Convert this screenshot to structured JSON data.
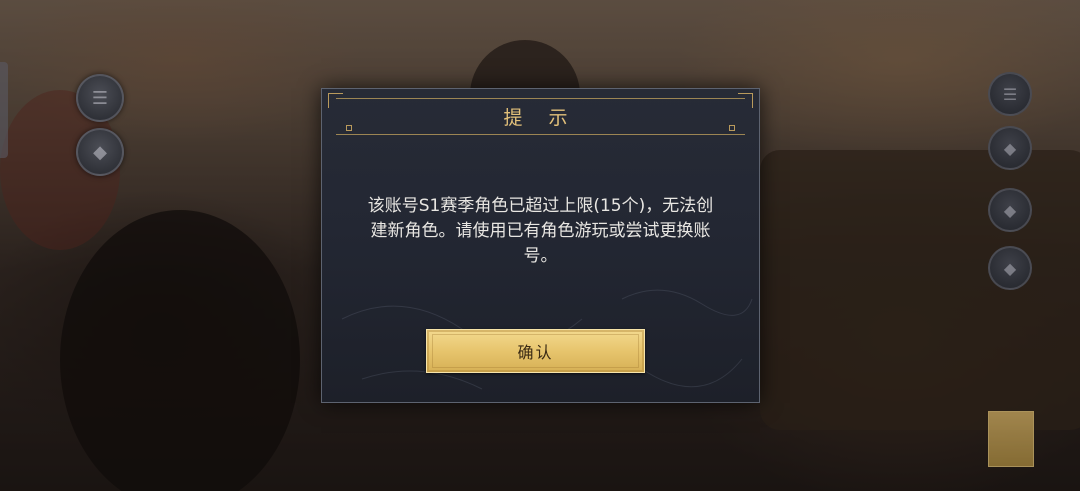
{
  "dialog": {
    "title": "提 示",
    "message": "该账号S1赛季角色已超过上限(15个)，无法创建新角色。请使用已有角色游玩或尝试更换账号。",
    "confirm_label": "确认"
  },
  "icons": {
    "left_buttons": [
      "round-menu-icon",
      "round-action-icon"
    ],
    "right_buttons": [
      "round-menu-icon",
      "round-action-icon",
      "round-action-icon",
      "round-action-icon"
    ]
  },
  "colors": {
    "title_gold": "#e2c07a",
    "button_gold": "#e7c56d",
    "dialog_bg": "#232733"
  }
}
